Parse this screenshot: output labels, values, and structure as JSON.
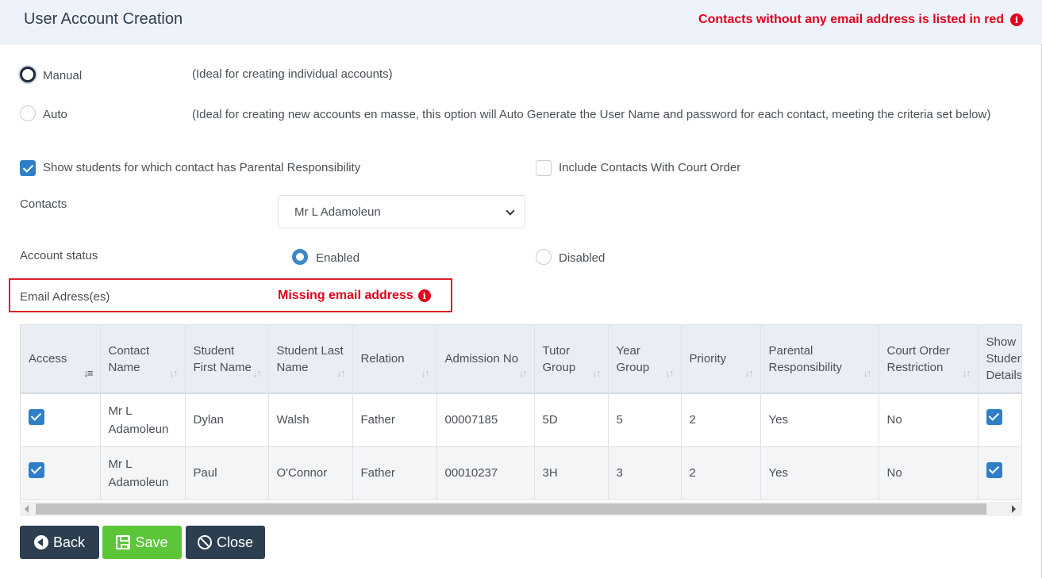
{
  "header": {
    "title": "User Account Creation",
    "note": "Contacts without any email address is listed in red"
  },
  "mode": {
    "manual_label": "Manual",
    "manual_desc": "(Ideal for creating individual accounts)",
    "auto_label": "Auto",
    "auto_desc": "(Ideal for creating new accounts en masse, this option will Auto Generate the User Name and password for each contact, meeting the criteria set below)",
    "selected": "Manual"
  },
  "options": {
    "parental_label": "Show students for which contact has Parental Responsibility",
    "parental_checked": true,
    "court_label": "Include Contacts With Court Order",
    "court_checked": false
  },
  "contacts": {
    "label": "Contacts",
    "selected": "Mr L Adamoleun"
  },
  "account_status": {
    "label": "Account status",
    "enabled_label": "Enabled",
    "disabled_label": "Disabled",
    "selected": "Enabled"
  },
  "email": {
    "label": "Email Adress(es)",
    "missing_text": "Missing email address"
  },
  "table": {
    "columns": [
      "Access",
      "Contact Name",
      "Student First Name",
      "Student Last Name",
      "Relation",
      "Admission No",
      "Tutor Group",
      "Year Group",
      "Priority",
      "Parental Responsibility",
      "Court Order Restriction",
      "Show Student Details"
    ],
    "rows": [
      {
        "access": true,
        "contact_name": "Mr L Adamoleun",
        "first_name": "Dylan",
        "last_name": "Walsh",
        "relation": "Father",
        "admission_no": "00007185",
        "tutor_group": "5D",
        "year_group": "5",
        "priority": "2",
        "parental": "Yes",
        "court_order": "No",
        "show_details": true
      },
      {
        "access": true,
        "contact_name": "Mr L Adamoleun",
        "first_name": "Paul",
        "last_name": "O'Connor",
        "relation": "Father",
        "admission_no": "00010237",
        "tutor_group": "3H",
        "year_group": "3",
        "priority": "2",
        "parental": "Yes",
        "court_order": "No",
        "show_details": true
      }
    ]
  },
  "buttons": {
    "back": "Back",
    "save": "Save",
    "close": "Close"
  },
  "colors": {
    "warning_red": "#e3001b",
    "primary_dark": "#2d3e50",
    "save_green": "#5cc639",
    "checkbox_blue": "#2f7fc8"
  }
}
